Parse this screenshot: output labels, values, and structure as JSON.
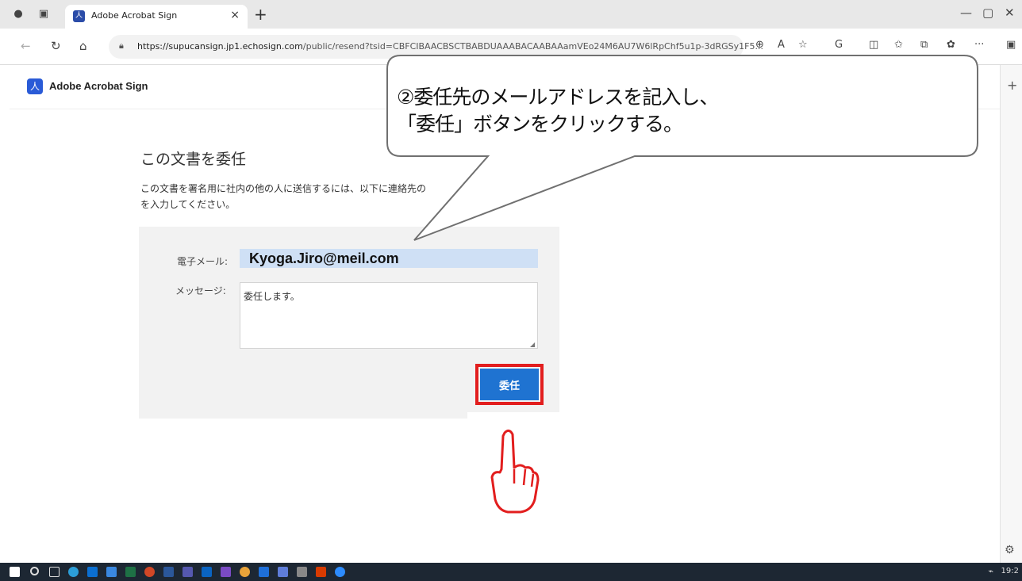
{
  "browser": {
    "tab_title": "Adobe Acrobat Sign",
    "tab_close": "×",
    "new_tab": "+",
    "url_host": "https://supucansign.jp1.echosign.com",
    "url_path": "/public/resend?tsid=CBFCIBAACBSCTBABDUAAABACAABAAamVEo24M6AU7W6lRpChf5u1p-3dRGSy1F5...",
    "window_controls": {
      "minimize": "—",
      "maximize": "▢",
      "close": "✕"
    },
    "sidebar_add": "+"
  },
  "app": {
    "name": "Adobe Acrobat Sign"
  },
  "page": {
    "heading": "この文書を委任",
    "description": "この文書を署名用に社内の他の人に送信するには、以下に連絡先の",
    "description_line2": "を入力してください。"
  },
  "form": {
    "email_label": "電子メール:",
    "email_value": "Kyoga.Jiro@meil.com",
    "message_label": "メッセージ:",
    "message_value": "委任します。",
    "submit_label": "委任"
  },
  "annotation": {
    "line1": "②委任先のメールアドレスを記入し、",
    "line2": "「委任」ボタンをクリックする。"
  },
  "taskbar": {
    "time": "19:2"
  },
  "icons": {
    "profile": "person-icon",
    "tabs": "tab-actions-icon",
    "back": "back-arrow-icon",
    "refresh": "refresh-icon",
    "home": "home-icon",
    "lock": "lock-icon",
    "zoom": "zoom-icon",
    "read_aloud": "read-aloud-icon",
    "favorite": "star-icon",
    "hand": "pointing-hand-icon"
  }
}
